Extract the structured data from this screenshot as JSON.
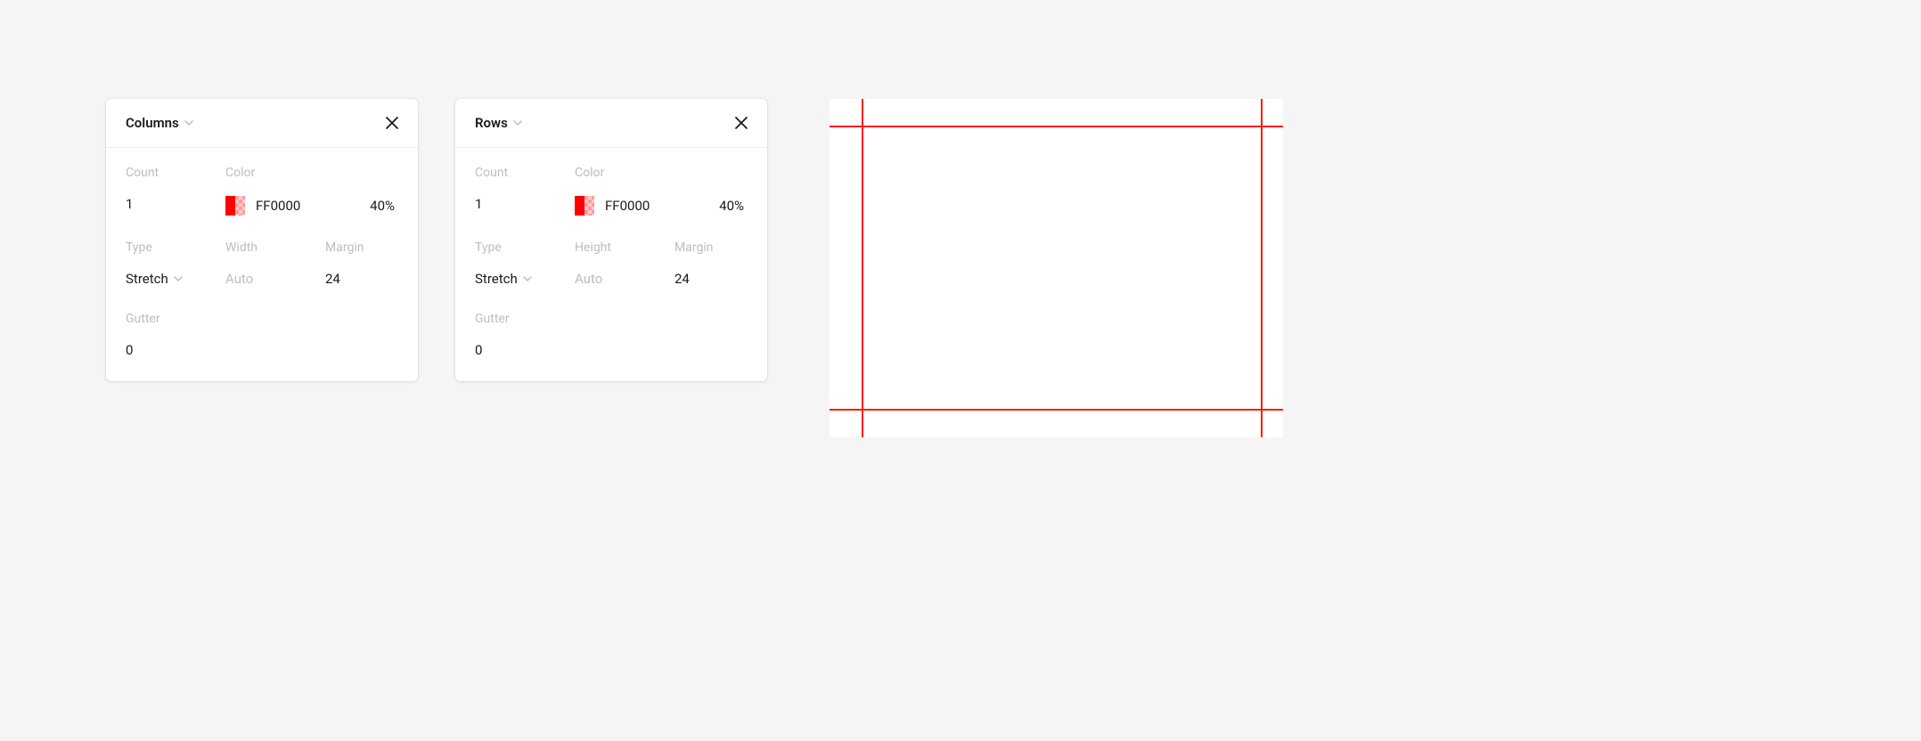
{
  "columns_panel": {
    "title": "Columns",
    "fields": {
      "count": {
        "label": "Count",
        "value": "1"
      },
      "color": {
        "label": "Color",
        "hex": "FF0000",
        "opacity": "40%"
      },
      "type": {
        "label": "Type",
        "value": "Stretch"
      },
      "size": {
        "label": "Width",
        "value": "Auto"
      },
      "margin": {
        "label": "Margin",
        "value": "24"
      },
      "gutter": {
        "label": "Gutter",
        "value": "0"
      }
    }
  },
  "rows_panel": {
    "title": "Rows",
    "fields": {
      "count": {
        "label": "Count",
        "value": "1"
      },
      "color": {
        "label": "Color",
        "hex": "FF0000",
        "opacity": "40%"
      },
      "type": {
        "label": "Type",
        "value": "Stretch"
      },
      "size": {
        "label": "Height",
        "value": "Auto"
      },
      "margin": {
        "label": "Margin",
        "value": "24"
      },
      "gutter": {
        "label": "Gutter",
        "value": "0"
      }
    }
  },
  "colors": {
    "grid_line": "#FF1A00",
    "swatch_solid": "#FF0000"
  }
}
